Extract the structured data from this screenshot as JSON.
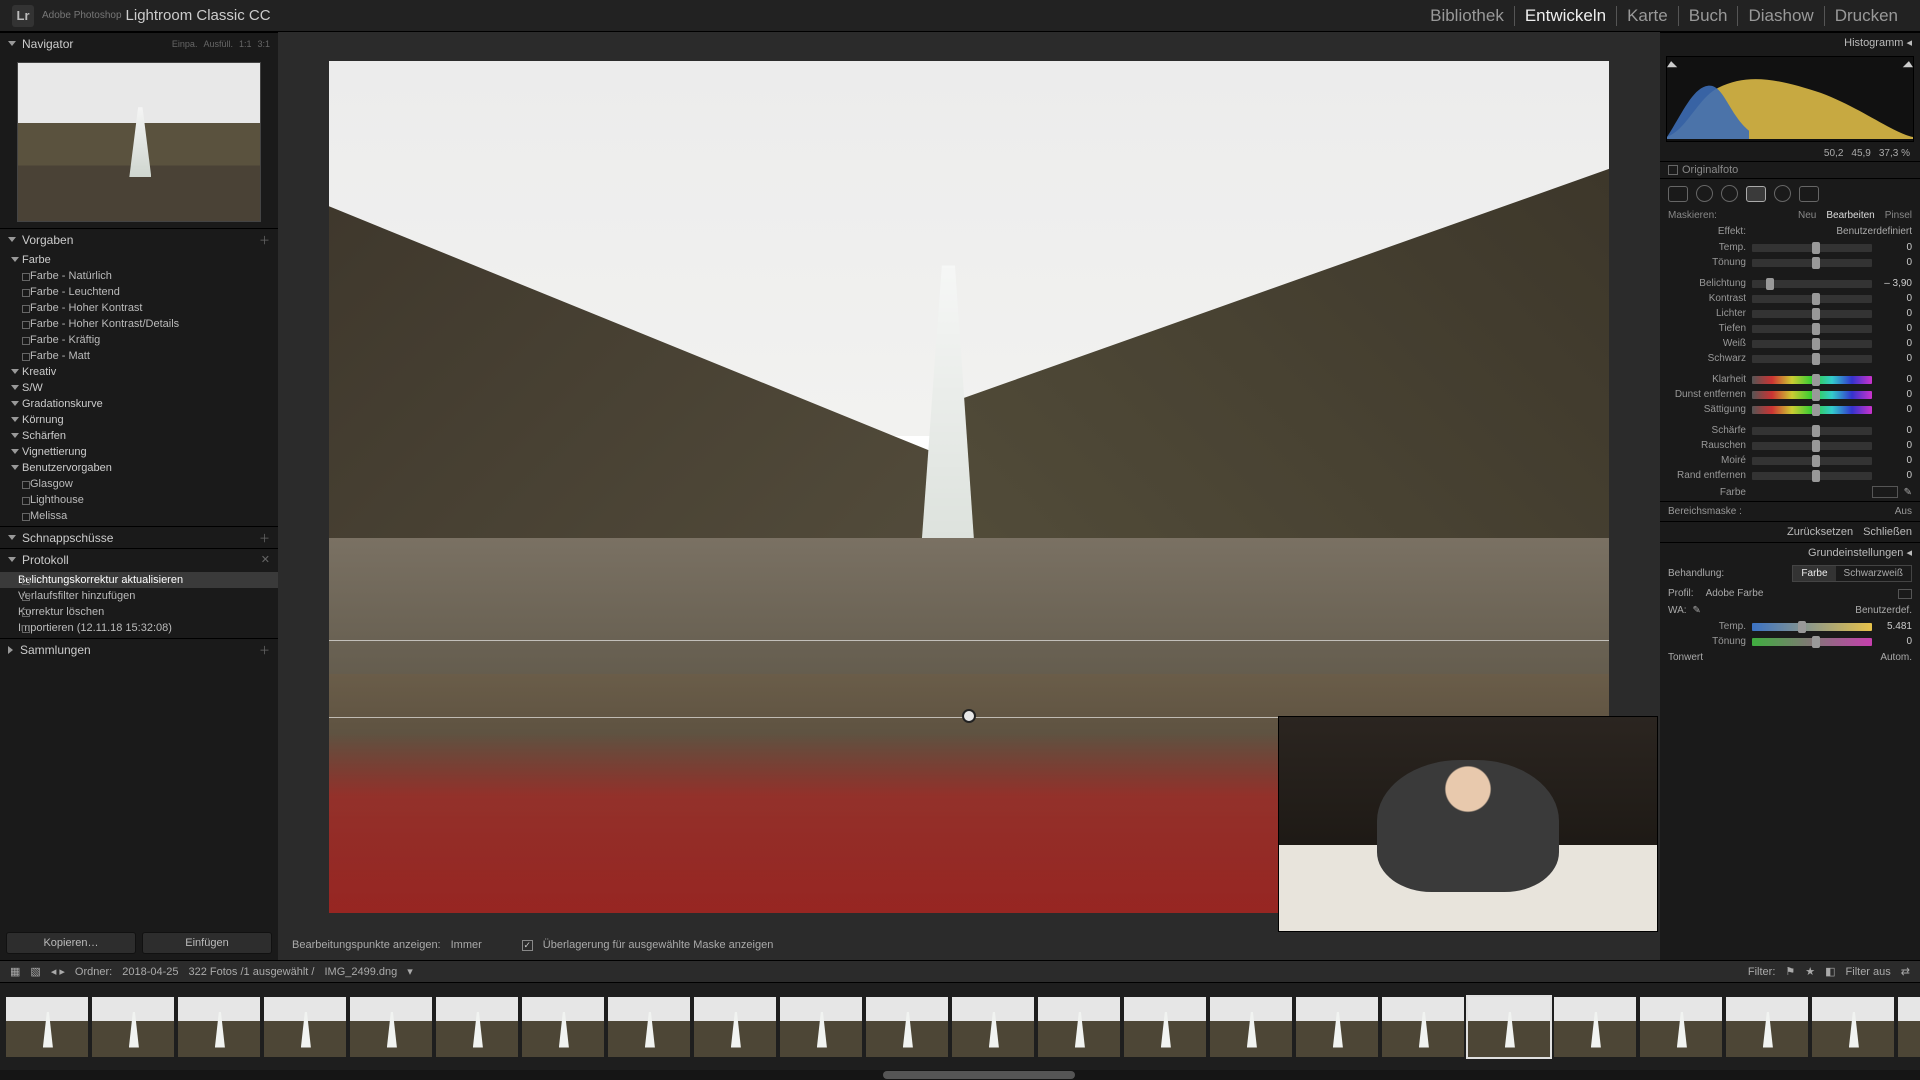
{
  "app": {
    "subtitle": "Adobe Photoshop",
    "title": "Lightroom Classic CC",
    "logo": "Lr"
  },
  "modules": {
    "items": [
      "Bibliothek",
      "Entwickeln",
      "Karte",
      "Buch",
      "Diashow",
      "Drucken"
    ],
    "active": 1
  },
  "navigator": {
    "title": "Navigator",
    "zoom": [
      "Einpa.",
      "Ausfüll.",
      "1:1",
      "3:1"
    ]
  },
  "presets": {
    "title": "Vorgaben",
    "groups": [
      {
        "label": "Farbe",
        "items": [
          "Farbe - Natürlich",
          "Farbe - Leuchtend",
          "Farbe - Hoher Kontrast",
          "Farbe - Hoher Kontrast/Details",
          "Farbe - Kräftig",
          "Farbe - Matt"
        ]
      },
      {
        "label": "Kreativ",
        "items": []
      },
      {
        "label": "S/W",
        "items": []
      }
    ],
    "curves": "Gradationskurve",
    "grain": "Körnung",
    "sharpen": "Schärfen",
    "vignette": "Vignettierung",
    "user_presets": {
      "label": "Benutzervorgaben",
      "items": [
        "Glasgow",
        "Lighthouse",
        "Melissa"
      ]
    }
  },
  "snapshots": {
    "title": "Schnappschüsse"
  },
  "history": {
    "title": "Protokoll",
    "items": [
      "Belichtungskorrektur aktualisieren",
      "Verlaufsfilter hinzufügen",
      "Korrektur löschen",
      "Importieren (12.11.18 15:32:08)"
    ],
    "selected": 0
  },
  "collections": {
    "title": "Sammlungen"
  },
  "left_buttons": {
    "copy": "Kopieren…",
    "paste": "Einfügen"
  },
  "center_bar": {
    "edit_points_label": "Bearbeitungspunkte anzeigen:",
    "edit_points_value": "Immer",
    "overlay_checked": true,
    "overlay_label": "Überlagerung für ausgewählte Maske anzeigen"
  },
  "histogram": {
    "title": "Histogramm",
    "values": [
      "50,2",
      "45,9",
      "37,3 %"
    ]
  },
  "original": "Originalfoto",
  "mask_tabs": {
    "label": "Maskieren:",
    "items": [
      "Neu",
      "Bearbeiten",
      "Pinsel"
    ],
    "active": 1
  },
  "effect": {
    "label": "Effekt:",
    "value": "Benutzerdefiniert"
  },
  "sliders_a": [
    {
      "label": "Temp.",
      "val": "0",
      "pos": 50
    },
    {
      "label": "Tönung",
      "val": "0",
      "pos": 50
    }
  ],
  "sliders_b": [
    {
      "label": "Belichtung",
      "val": "– 3,90",
      "pos": 12
    },
    {
      "label": "Kontrast",
      "val": "0",
      "pos": 50
    },
    {
      "label": "Lichter",
      "val": "0",
      "pos": 50
    },
    {
      "label": "Tiefen",
      "val": "0",
      "pos": 50
    },
    {
      "label": "Weiß",
      "val": "0",
      "pos": 50
    },
    {
      "label": "Schwarz",
      "val": "0",
      "pos": 50
    }
  ],
  "sliders_c": [
    {
      "label": "Klarheit",
      "val": "0",
      "pos": 50
    },
    {
      "label": "Dunst entfernen",
      "val": "0",
      "pos": 50
    },
    {
      "label": "Sättigung",
      "val": "0",
      "pos": 50
    }
  ],
  "sliders_d": [
    {
      "label": "Schärfe",
      "val": "0",
      "pos": 50
    },
    {
      "label": "Rauschen",
      "val": "0",
      "pos": 50
    },
    {
      "label": "Moiré",
      "val": "0",
      "pos": 50
    },
    {
      "label": "Rand entfernen",
      "val": "0",
      "pos": 50
    }
  ],
  "color_row": {
    "label": "Farbe"
  },
  "range_mask": {
    "label": "Bereichsmaske :",
    "value": "Aus"
  },
  "actions": {
    "reset": "Zurücksetzen",
    "close": "Schließen"
  },
  "basic": {
    "title": "Grundeinstellungen",
    "treat_label": "Behandlung:",
    "treat_options": [
      "Farbe",
      "Schwarzweiß"
    ],
    "treat_active": 0,
    "profile_label": "Profil:",
    "profile_value": "Adobe Farbe",
    "wb_label": "WA:",
    "wb_value": "Benutzerdef.",
    "temp_label": "Temp.",
    "temp_value": "5.481",
    "tint_label": "Tönung",
    "tint_value": "0",
    "tone_label": "Tonwert",
    "tone_auto": "Autom."
  },
  "strip": {
    "folder_label": "Ordner:",
    "folder_date": "2018-04-25",
    "count_text": "322 Fotos /1 ausgewählt /",
    "filename": "IMG_2499.dng",
    "filter_label": "Filter:",
    "filter_off": "Filter aus"
  },
  "thumb_count": 23,
  "thumb_selected": 17
}
